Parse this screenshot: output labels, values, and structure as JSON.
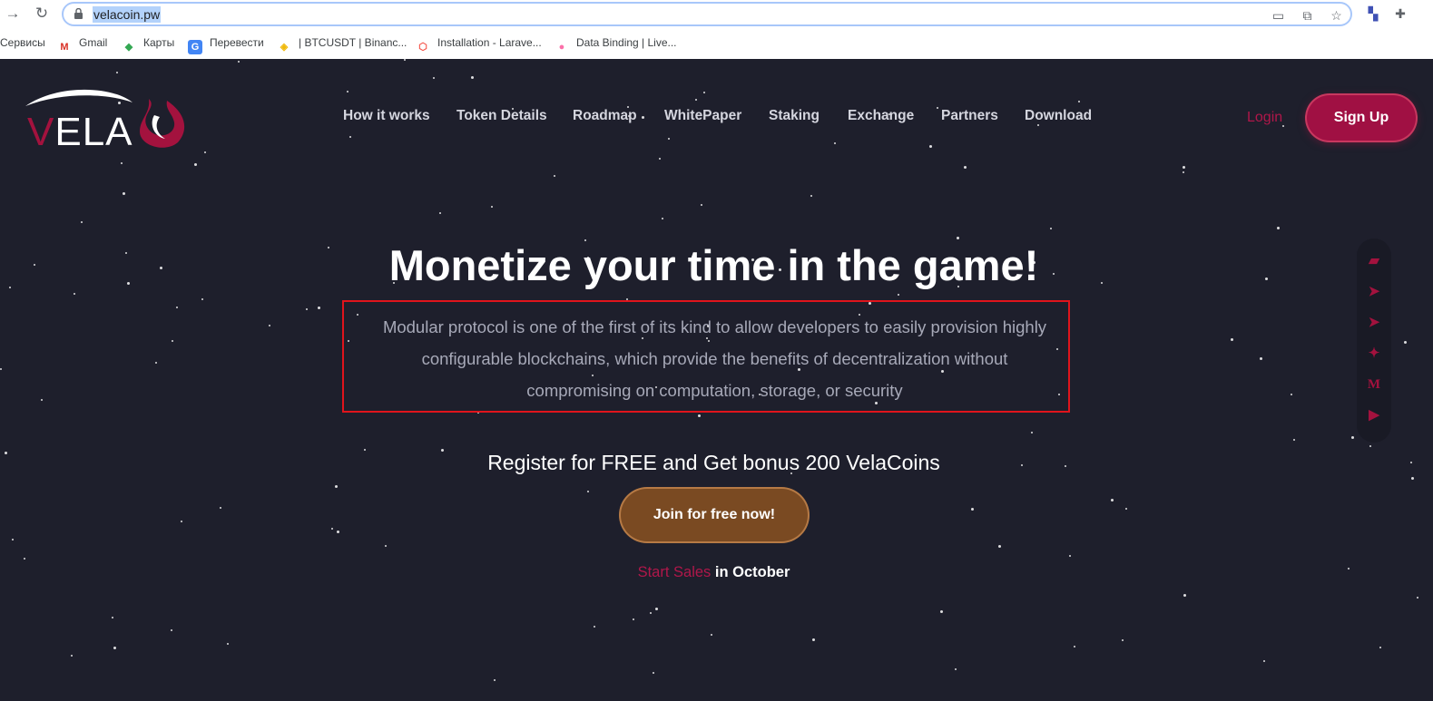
{
  "browser": {
    "url": "velacoin.pw",
    "bookmarks": [
      {
        "label": "Сервисы",
        "icon": "apps-icon"
      },
      {
        "label": "Gmail",
        "icon": "gmail-icon"
      },
      {
        "label": "Карты",
        "icon": "maps-icon"
      },
      {
        "label": "Перевести",
        "icon": "translate-icon"
      },
      {
        "label": "| BTCUSDT | Binanc...",
        "icon": "binance-icon"
      },
      {
        "label": "Installation - Larave...",
        "icon": "laravel-icon"
      },
      {
        "label": "Data Binding | Live...",
        "icon": "livewire-icon"
      }
    ]
  },
  "site": {
    "logo": {
      "v": "V",
      "rest": "ELA"
    },
    "nav": [
      "How it works",
      "Token Details",
      "Roadmap",
      "WhitePaper",
      "Staking",
      "Exchange",
      "Partners",
      "Download"
    ],
    "login": "Login",
    "signup": "Sign Up",
    "accent_color": "#a3123e"
  },
  "hero": {
    "title": "Monetize your time in the game!",
    "description": "Modular protocol is one of the first of its kind to allow developers to easily provision highly configurable blockchains, which provide the benefits of decentralization without compromising on computation, storage, or security",
    "register": "Register for FREE and Get bonus 200 VelaCoins",
    "join_button": "Join for free now!",
    "sales_highlight": "Start Sales",
    "sales_rest": " in October"
  },
  "social": [
    "wallet-icon",
    "telegram-icon",
    "telegram-icon",
    "twitter-icon",
    "medium-icon",
    "youtube-icon"
  ]
}
